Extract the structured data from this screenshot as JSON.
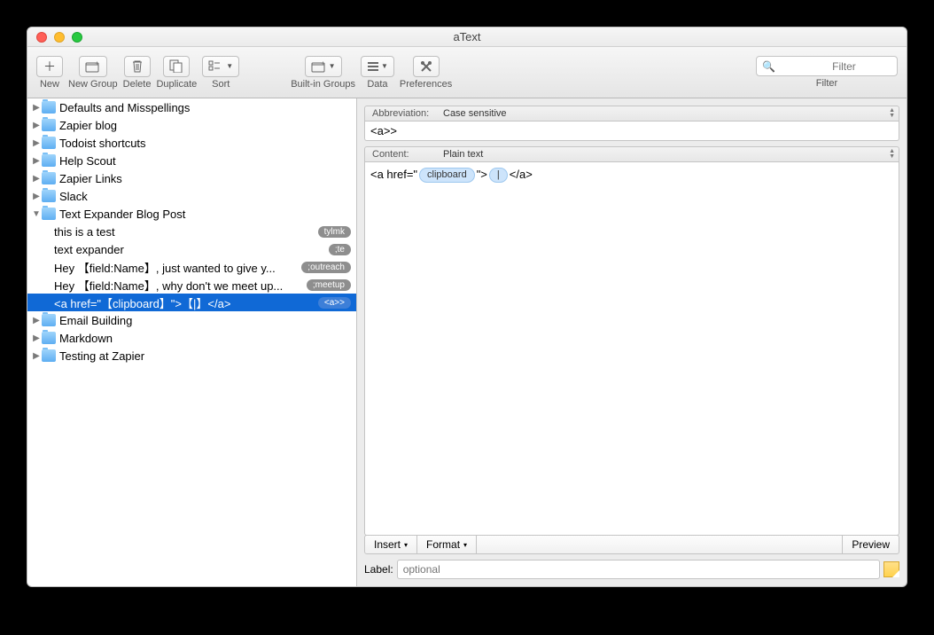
{
  "window": {
    "title": "aText"
  },
  "toolbar": {
    "new": "New",
    "new_group": "New Group",
    "delete": "Delete",
    "duplicate": "Duplicate",
    "sort": "Sort",
    "builtin": "Built-in Groups",
    "data": "Data",
    "prefs": "Preferences",
    "filter_label": "Filter",
    "filter_placeholder": "Filter"
  },
  "sidebar": {
    "groups": [
      {
        "name": "Defaults and Misspellings",
        "exp": false
      },
      {
        "name": "Zapier blog",
        "exp": false
      },
      {
        "name": "Todoist shortcuts",
        "exp": false
      },
      {
        "name": "Help Scout",
        "exp": false
      },
      {
        "name": "Zapier Links",
        "exp": false
      },
      {
        "name": "Slack",
        "exp": false
      },
      {
        "name": "Text Expander Blog Post",
        "exp": true
      },
      {
        "name": "Email Building",
        "exp": false
      },
      {
        "name": "Markdown",
        "exp": false
      },
      {
        "name": "Testing at Zapier",
        "exp": false
      }
    ],
    "snippets": [
      {
        "text": "this is a test",
        "abbr": "tylmk",
        "sel": false
      },
      {
        "text": "text expander",
        "abbr": ";te",
        "sel": false
      },
      {
        "text": "Hey 【field:Name】, just wanted to give y...",
        "abbr": ";outreach",
        "sel": false
      },
      {
        "text": "Hey 【field:Name】, why don't we meet up...",
        "abbr": ";meetup",
        "sel": false
      },
      {
        "text": "<a href=\"【clipboard】\">【|】</a>",
        "abbr": "<a>>",
        "sel": true
      }
    ]
  },
  "editor": {
    "abbr_label": "Abbreviation:",
    "abbr_mode": "Case sensitive",
    "abbr_value": "<a>>",
    "content_label": "Content:",
    "content_mode": "Plain text",
    "content_parts": {
      "p1": "<a href=\"",
      "token1": "clipboard",
      "p2": "\">",
      "token2": "|",
      "p3": "</a>"
    },
    "insert": "Insert",
    "format": "Format",
    "preview": "Preview",
    "label_label": "Label:",
    "label_placeholder": "optional"
  }
}
